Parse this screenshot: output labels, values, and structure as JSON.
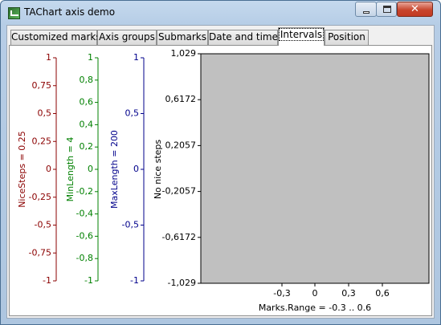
{
  "window": {
    "title": "TAChart axis demo"
  },
  "tabs": [
    {
      "label": "Customized marks",
      "active": false
    },
    {
      "label": "Axis groups",
      "active": false
    },
    {
      "label": "Submarks",
      "active": false
    },
    {
      "label": "Date and time",
      "active": false
    },
    {
      "label": "Intervals",
      "active": true
    },
    {
      "label": "Position",
      "active": false
    }
  ],
  "colors": {
    "red": "#8b0000",
    "green": "#008000",
    "blue": "#00008b",
    "plot_bg": "#c0c0c0"
  },
  "axes": {
    "a1": {
      "title": "NiceSteps = 0.25",
      "labels": [
        "1",
        "0,75",
        "0,5",
        "0,25",
        "0",
        "-0,25",
        "-0,5",
        "-0,75",
        "-1"
      ]
    },
    "a2": {
      "title": "MinLength = 4",
      "labels": [
        "1",
        "0,8",
        "0,6",
        "0,4",
        "0,2",
        "0",
        "-0,2",
        "-0,4",
        "-0,6",
        "-0,8",
        "-1"
      ]
    },
    "a3": {
      "title": "MaxLength = 200",
      "labels": [
        "1",
        "0,5",
        "0",
        "-0,5",
        "-1"
      ]
    },
    "a4": {
      "title": "No nice steps",
      "labels": [
        "1,029",
        "0,6172",
        "0,2057",
        "-0,2057",
        "-0,6172",
        "-1,029"
      ]
    }
  },
  "bottom_axis": {
    "title": "Marks.Range = -0.3 .. 0.6",
    "labels": [
      "-0,3",
      "0",
      "0,3",
      "0,6"
    ]
  }
}
